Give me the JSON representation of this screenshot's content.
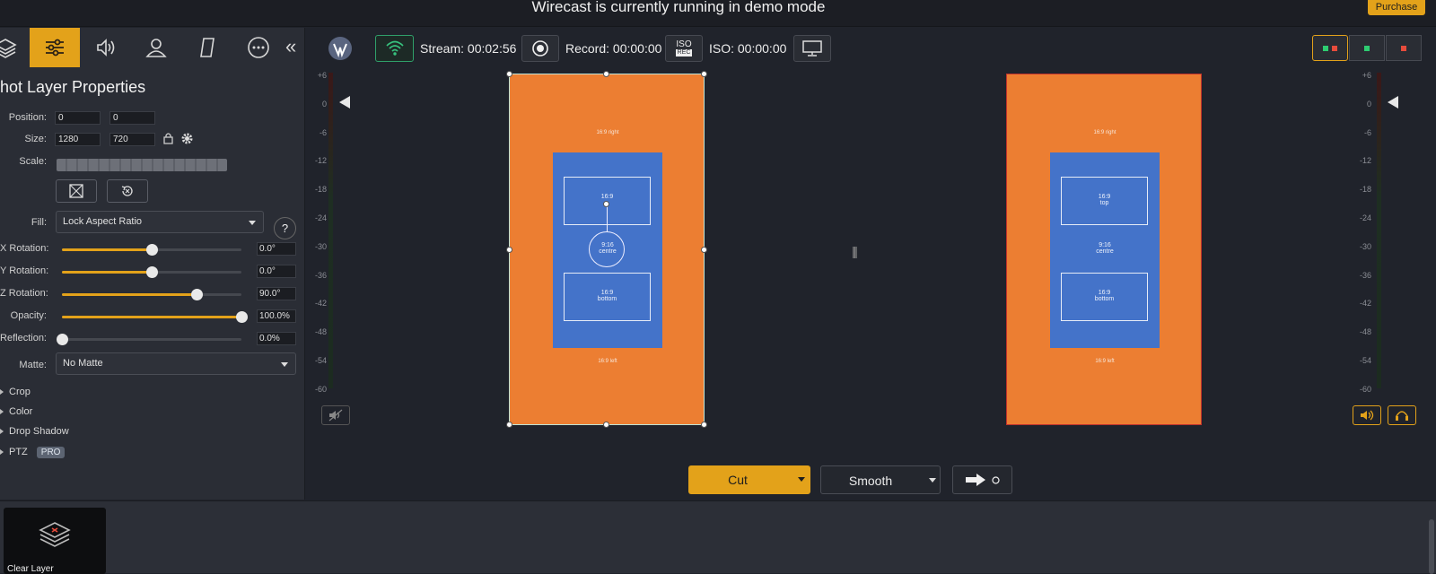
{
  "banner": {
    "message": "Wirecast is currently running in demo mode",
    "purchase_label": "Purchase"
  },
  "left_panel": {
    "tabs": [
      {
        "name": "layers-icon"
      },
      {
        "name": "sliders-icon",
        "active": true
      },
      {
        "name": "audio-icon"
      },
      {
        "name": "user-icon"
      },
      {
        "name": "skew-icon"
      },
      {
        "name": "more-icon"
      }
    ],
    "collapse_glyph": "«",
    "title": "hot Layer Properties",
    "position": {
      "label": "Position:",
      "x": "0",
      "y": "0"
    },
    "size": {
      "label": "Size:",
      "w": "1280",
      "h": "720"
    },
    "scale_label": "Scale:",
    "fill": {
      "label": "Fill:",
      "value": "Lock Aspect Ratio"
    },
    "help_label": "?",
    "sliders": [
      {
        "label": "X Rotation:",
        "value": "0.0°",
        "fraction": 0.5
      },
      {
        "label": "Y Rotation:",
        "value": "0.0°",
        "fraction": 0.5
      },
      {
        "label": "Z Rotation:",
        "value": "90.0°",
        "fraction": 0.75
      },
      {
        "label": "Opacity:",
        "value": "100.0%",
        "fraction": 1.0
      },
      {
        "label": "Reflection:",
        "value": "0.0%",
        "fraction": 0.0
      }
    ],
    "matte": {
      "label": "Matte:",
      "value": "No Matte"
    },
    "sections": [
      "Crop",
      "Color",
      "Drop Shadow",
      "PTZ"
    ],
    "pro_badge": "PRO"
  },
  "toolbar": {
    "stream_label": "Stream: 00:02:56",
    "record_label": "Record: 00:00:00",
    "iso_button": {
      "top": "ISO",
      "bottom": "REC"
    },
    "iso_label": "ISO: 00:00:00"
  },
  "meter": {
    "scale": [
      "+6",
      "0",
      "-6",
      "-12",
      "-18",
      "-24",
      "-30",
      "-36",
      "-42",
      "-48",
      "-54",
      "-60"
    ]
  },
  "preview": {
    "top_side_text": "16:9 right",
    "bottom_side_text": "16:9 left",
    "top_box": [
      "16:9",
      "top"
    ],
    "bottom_box": [
      "16:9",
      "bottom"
    ],
    "middle_text": [
      "9:16",
      "centre"
    ]
  },
  "transitions": {
    "cut_label": "Cut",
    "smooth_label": "Smooth"
  },
  "shots": {
    "clear_layer_label": "Clear Layer"
  },
  "colors": {
    "accent": "#e3a21a",
    "preview_orange": "#ec7e32",
    "inner_blue": "#4473c9",
    "stream_green": "#2fa06a",
    "live_red": "#c0322c"
  }
}
